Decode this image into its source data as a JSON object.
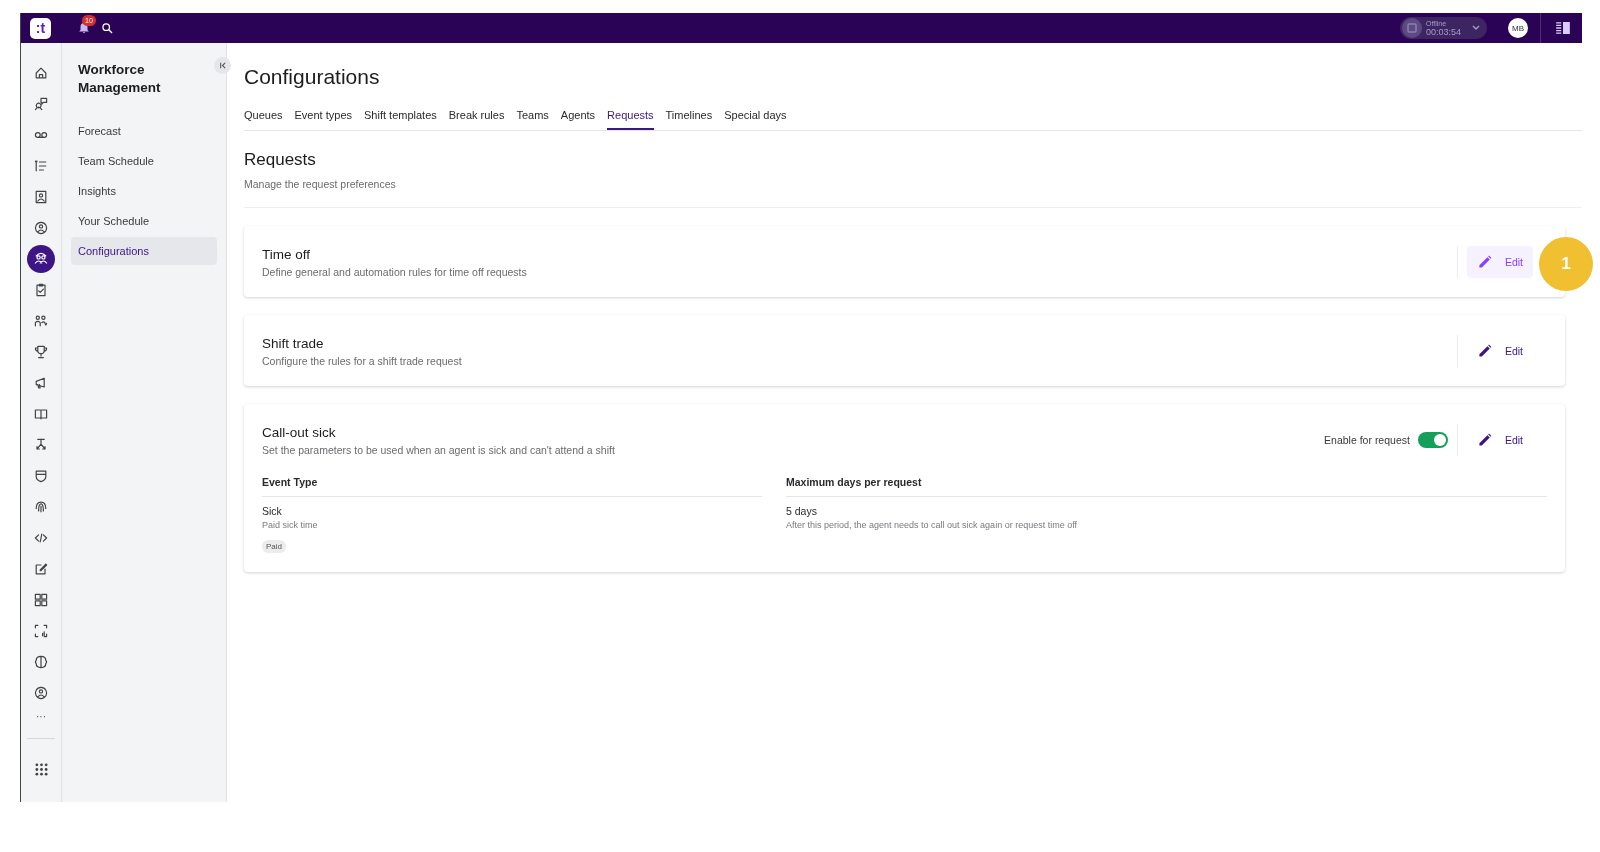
{
  "topbar": {
    "logo": ":t",
    "notifications": "10",
    "status": {
      "label": "Offline",
      "timer": "00:03:54"
    },
    "avatar": "MB"
  },
  "rail": {
    "items": [
      {
        "selected": false
      },
      {
        "selected": false
      },
      {
        "selected": false
      },
      {
        "selected": false
      },
      {
        "selected": false
      },
      {
        "selected": false
      },
      {
        "selected": true
      },
      {
        "selected": false
      },
      {
        "selected": false
      },
      {
        "selected": false
      },
      {
        "selected": false
      },
      {
        "selected": false
      },
      {
        "selected": false
      },
      {
        "selected": false
      },
      {
        "selected": false
      },
      {
        "selected": false
      },
      {
        "selected": false
      },
      {
        "selected": false
      },
      {
        "selected": false
      },
      {
        "selected": false
      },
      {
        "selected": false
      }
    ],
    "more": "···"
  },
  "sidebar": {
    "title": "Workforce Management",
    "items": [
      {
        "label": "Forecast",
        "selected": false
      },
      {
        "label": "Team Schedule",
        "selected": false
      },
      {
        "label": "Insights",
        "selected": false
      },
      {
        "label": "Your Schedule",
        "selected": false
      },
      {
        "label": "Configurations",
        "selected": true
      }
    ]
  },
  "page": {
    "title": "Configurations",
    "tabs": [
      {
        "label": "Queues",
        "selected": false
      },
      {
        "label": "Event types",
        "selected": false
      },
      {
        "label": "Shift templates",
        "selected": false
      },
      {
        "label": "Break rules",
        "selected": false
      },
      {
        "label": "Teams",
        "selected": false
      },
      {
        "label": "Agents",
        "selected": false
      },
      {
        "label": "Requests",
        "selected": true
      },
      {
        "label": "Timelines",
        "selected": false
      },
      {
        "label": "Special days",
        "selected": false
      }
    ]
  },
  "section": {
    "title": "Requests",
    "subtitle": "Manage the request preferences"
  },
  "cards": [
    {
      "title": "Time off",
      "description": "Define general and automation rules for time off requests",
      "edit": {
        "label": "Edit",
        "hovered": true
      }
    },
    {
      "title": "Shift trade",
      "description": "Configure the rules for a shift trade request",
      "edit": {
        "label": "Edit",
        "hovered": false
      }
    },
    {
      "title": "Call-out sick",
      "description": "Set the parameters to be used when an agent is sick and can't attend a shift",
      "edit": {
        "label": "Edit",
        "hovered": false
      },
      "toggle": {
        "label": "Enable for request",
        "on": true
      },
      "details": [
        {
          "heading": "Event Type",
          "value": "Sick",
          "note": "Paid sick time",
          "tag": "Paid"
        },
        {
          "heading": "Maximum days per request",
          "value": "5 days",
          "note": "After this period, the agent needs to call out sick again or request time off"
        }
      ]
    }
  ],
  "callout": "1"
}
